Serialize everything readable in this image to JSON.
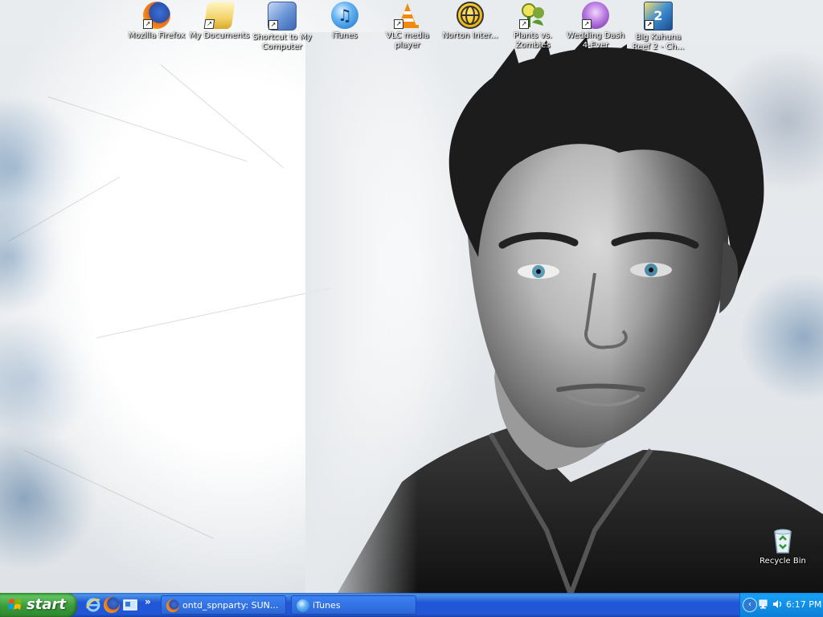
{
  "desktop": {
    "icons": [
      {
        "label": "Mozilla Firefox",
        "icon": "firefox-icon"
      },
      {
        "label": "My Documents",
        "icon": "folder-documents-icon"
      },
      {
        "label": "Shortcut to My Computer",
        "icon": "my-computer-icon"
      },
      {
        "label": "iTunes",
        "icon": "itunes-icon"
      },
      {
        "label": "VLC media player",
        "icon": "vlc-cone-icon"
      },
      {
        "label": "Norton Inter...",
        "icon": "norton-globe-icon"
      },
      {
        "label": "Plants vs. Zombies",
        "icon": "plants-vs-zombies-icon"
      },
      {
        "label": "Wedding Dash 4-Ever",
        "icon": "wedding-dash-icon"
      },
      {
        "label": "Big Kahuna Reef 2 - Ch...",
        "icon": "big-kahuna-icon"
      }
    ],
    "recycle_bin": {
      "label": "Recycle Bin",
      "icon": "recycle-bin-icon"
    }
  },
  "taskbar": {
    "start_label": "start",
    "quick_launch": [
      "internet-explorer-icon",
      "firefox-icon",
      "show-desktop-icon"
    ],
    "overflow_label": "»",
    "tasks": [
      {
        "label": "ontd_spnparty: SUN...",
        "icon": "firefox-icon"
      },
      {
        "label": "iTunes",
        "icon": "itunes-icon"
      }
    ],
    "tray": {
      "expand_label": "‹",
      "clock": "6:17 PM"
    }
  },
  "colors": {
    "taskbar_blue": "#2157d7",
    "start_green": "#3b9b3b",
    "tray_blue": "#1290e8"
  }
}
